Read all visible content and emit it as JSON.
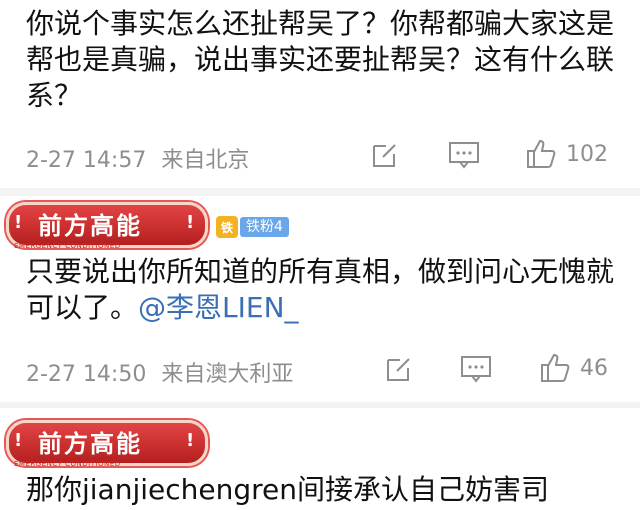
{
  "comments": [
    {
      "text": "你说个事实怎么还扯帮吴了？你帮都骗大家这是帮也是真骗，说出事实还要扯帮吴？这有什么联系？",
      "date": "2-27 14:57",
      "location": "来自北京",
      "likes": "102"
    },
    {
      "badge": {
        "label": "前方高能",
        "bang": "!",
        "sub": "EMERGENCY CONDITIONED"
      },
      "fan_badge": {
        "icon": "铁",
        "label": "铁粉4"
      },
      "text": "只要说出你所知道的所有真相，做到问心无愧就可以了。",
      "mention": "@李恩LIEN_",
      "date": "2-27 14:50",
      "location": "来自澳大利亚",
      "likes": "46"
    },
    {
      "badge": {
        "label": "前方高能",
        "bang": "!",
        "sub": "EMERGENCY CONDITIONED"
      },
      "text": "那你jianjiechengren间接承认自己妨害司"
    }
  ],
  "icons": {
    "edit": "edit-icon",
    "comment": "comment-icon",
    "like": "thumbs-up-icon"
  },
  "colors": {
    "mention": "#3a6fb5",
    "badge": "#c62828",
    "fan_badge": "#6aa7ea"
  }
}
